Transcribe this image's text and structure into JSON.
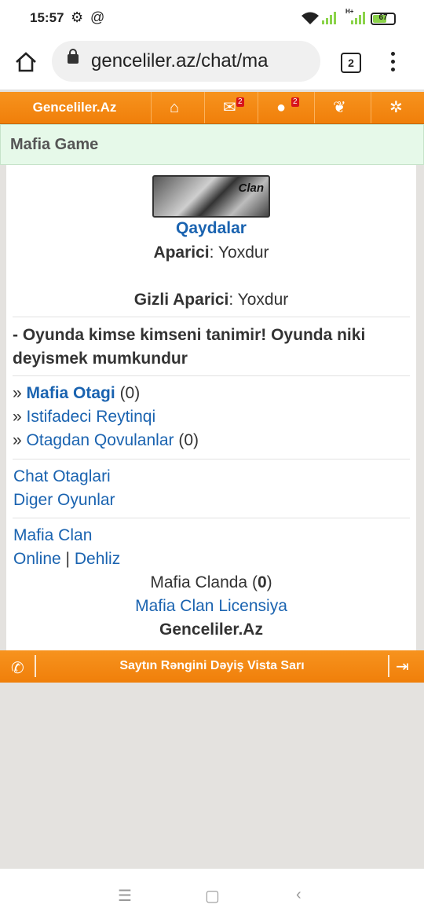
{
  "status_bar": {
    "time": "15:57",
    "signal_label": "H+",
    "battery": "67"
  },
  "browser": {
    "url": "genceliler.az/chat/ma",
    "tab_count": "2"
  },
  "site_nav": {
    "brand": "Genceliler.Az",
    "items": [
      {
        "icon": "home-icon"
      },
      {
        "icon": "mail-icon",
        "badge": "2"
      },
      {
        "icon": "globe-icon",
        "badge": "2"
      },
      {
        "icon": "footprints-icon"
      },
      {
        "icon": "gear-icon"
      }
    ]
  },
  "page": {
    "title": "Mafia Game",
    "logo_text": "Clan",
    "rules_link": "Qaydalar",
    "host_label": "Aparici",
    "host_value": ": Yoxdur",
    "hidden_host_label": "Gizli Aparici",
    "hidden_host_value": ": Yoxdur",
    "notice": "- Oyunda kimse kimseni tanimir! Oyunda niki deyismek mumkundur",
    "links1": {
      "mafia_room": "Mafia Otagi",
      "mafia_room_count": "(0)",
      "rating": "Istifadeci Reytinqi",
      "kicked": "Otagdan Qovulanlar",
      "kicked_count": "(0)",
      "bullet": "»"
    },
    "links2": {
      "chat_rooms": "Chat Otaglari",
      "other_games": "Diger Oyunlar"
    },
    "clan": {
      "mafia_clan": "Mafia Clan",
      "online": "Online",
      "divider": "|",
      "lobby": "Dehliz",
      "in_clan_prefix": "Mafia Clanda (",
      "in_clan_count": "0",
      "in_clan_suffix": ")",
      "license": "Mafia Clan Licensiya",
      "site_name": "Genceliler.Az"
    }
  },
  "footer": {
    "text": "Saytın Rəngini Dəyiş Vista Sarı"
  },
  "colors": {
    "accent_orange": "#f7931e",
    "link_blue": "#1a63b0",
    "header_green": "#e6f9e9"
  }
}
